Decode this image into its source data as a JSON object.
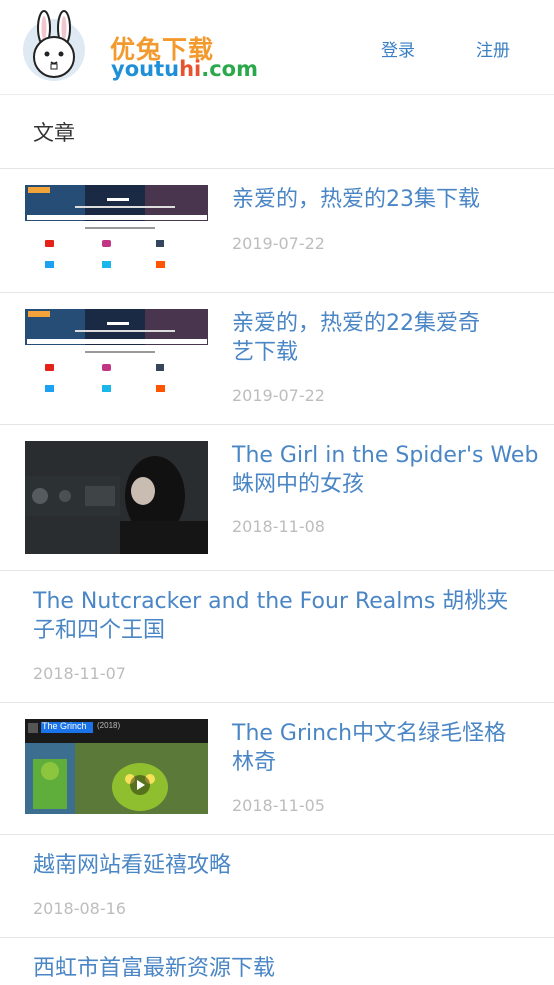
{
  "header": {
    "logo_cn": "优兔下载",
    "logo_en_you": "you",
    "logo_en_tu": "tu",
    "logo_en_hi": "hi",
    "logo_en_com": ".com",
    "login": "登录",
    "register": "注册"
  },
  "section": {
    "title": "文章"
  },
  "articles": [
    {
      "title": "亲爱的，热爱的23集下载",
      "date": "2019-07-22",
      "thumb": "site-screenshot"
    },
    {
      "title": "亲爱的，热爱的22集爱奇艺下载",
      "title_line1": "亲爱的，热爱的22集爱奇",
      "title_line2": "艺下载",
      "date": "2019-07-22",
      "thumb": "site-screenshot"
    },
    {
      "title_line1": "The Girl in the Spider's Web",
      "title_line2": "蛛网中的女孩",
      "date": "2018-11-08",
      "thumb": "movie-still"
    },
    {
      "title_line1": "The Nutcracker and the Four Realms 胡桃夹",
      "title_line2": "子和四个王国",
      "date": "2018-11-07"
    },
    {
      "title_line1": "The Grinch中文名绿毛怪格",
      "title_line2": "林奇",
      "date": "2018-11-05",
      "thumb": "imdb-page",
      "thumb_title": "The Grinch",
      "thumb_year": "(2018)"
    },
    {
      "title": "越南网站看延禧攻略",
      "date": "2018-08-16"
    },
    {
      "title": "西虹市首富最新资源下载"
    }
  ],
  "colors": {
    "link": "#4a86c5",
    "date": "#bdbdbd",
    "nav": "#3a7fc4",
    "logo_orange": "#f29a2e"
  }
}
